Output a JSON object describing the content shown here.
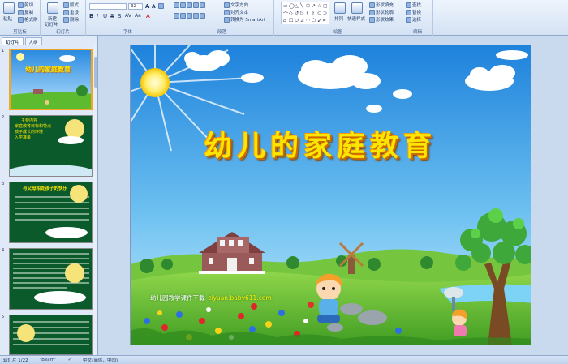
{
  "ribbon": {
    "groups": [
      {
        "label": "剪贴板"
      },
      {
        "label": "幻灯片"
      },
      {
        "label": "字体"
      },
      {
        "label": "段落"
      },
      {
        "label": "绘图"
      },
      {
        "label": "编辑"
      }
    ],
    "clipboard": {
      "paste": "粘贴",
      "cut": "剪切",
      "copy": "复制",
      "format_painter": "格式刷"
    },
    "slides": {
      "new_slide": "新建",
      "new_slide2": "幻灯片",
      "layout": "版式",
      "reset": "重设",
      "delete": "删除"
    },
    "font": {
      "font_name": "",
      "font_size": "32"
    },
    "paragraph": {
      "text_direction": "文字方向",
      "align_text": "对齐文本",
      "convert_smartart": "转换为 SmartArt"
    },
    "drawing": {
      "arrange": "排列",
      "quick_styles": "快速样式",
      "shape_fill": "形状填充",
      "shape_outline": "形状轮廓",
      "shape_effects": "形状效果"
    },
    "editing": {
      "find": "查找",
      "replace": "替换",
      "select": "选择"
    }
  },
  "panel": {
    "tabs": [
      {
        "label": "幻灯片"
      },
      {
        "label": "大纲"
      }
    ],
    "slide_numbers": [
      "1",
      "2",
      "3",
      "4",
      "5"
    ],
    "thumb1_title": "幼儿的家庭教育",
    "thumb2_lines": [
      "主要内容",
      "家庭教育目标和特点",
      "孩子成长的环境",
      "入学准备"
    ],
    "thumb3_title": "与父母相处孩子的快乐"
  },
  "slide": {
    "title": "幼儿的家庭教育",
    "caption": "幼儿园教学课件下载",
    "url": "ziyuan.baby611.com"
  },
  "statusbar": {
    "slide_info": "幻灯片 1/22",
    "theme": "\"Beam\"",
    "language": "中文(简体，中国)"
  },
  "colors": {
    "sky_top": "#2a8be0",
    "sky_bottom": "#bfe6ff",
    "grass": "#5dbb2f",
    "title_yellow": "#fce500",
    "title_shadow": "#c96a00",
    "selection_border": "#f4a623"
  }
}
